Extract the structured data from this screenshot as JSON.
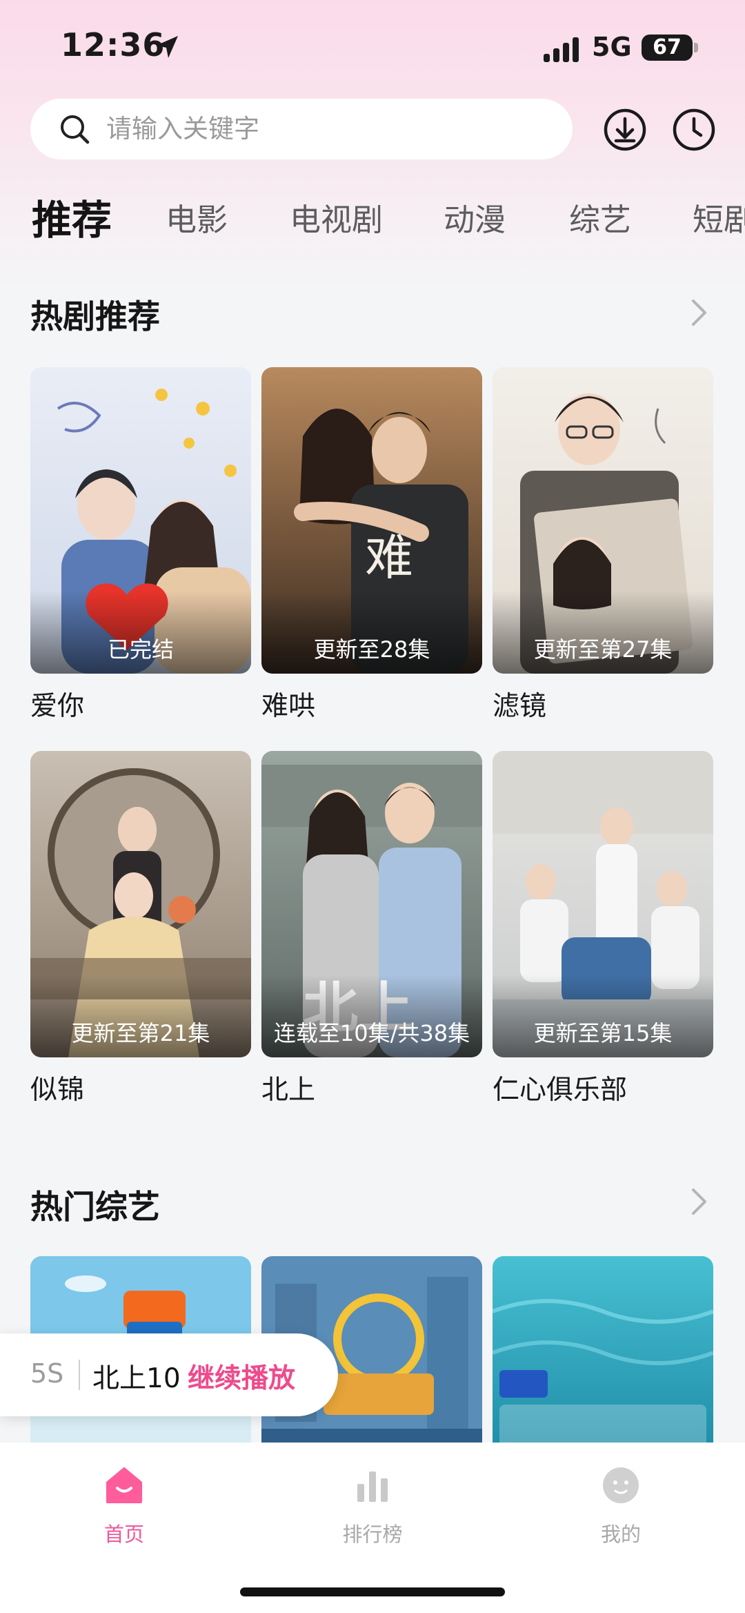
{
  "status_bar": {
    "time": "12:36",
    "network": "5G",
    "battery": "67"
  },
  "search": {
    "placeholder": "请输入关键字"
  },
  "tabs": [
    {
      "label": "推荐",
      "active": true
    },
    {
      "label": "电影"
    },
    {
      "label": "电视剧"
    },
    {
      "label": "动漫"
    },
    {
      "label": "综艺"
    },
    {
      "label": "短剧"
    }
  ],
  "sections": {
    "hot_dramas": {
      "title": "热剧推荐",
      "items": [
        {
          "title": "爱你",
          "badge": "已完结"
        },
        {
          "title": "难哄",
          "badge": "更新至28集"
        },
        {
          "title": "滤镜",
          "badge": "更新至第27集"
        },
        {
          "title": "似锦",
          "badge": "更新至第21集"
        },
        {
          "title": "北上",
          "badge": "连载至10集/共38集"
        },
        {
          "title": "仁心俱乐部",
          "badge": "更新至第15集"
        }
      ]
    },
    "hot_variety": {
      "title": "热门综艺"
    }
  },
  "continue_watching": {
    "time": "5S",
    "title": "北上10",
    "action": "继续播放"
  },
  "bottom_nav": [
    {
      "label": "首页",
      "icon": "home-icon",
      "active": true
    },
    {
      "label": "排行榜",
      "icon": "ranking-icon"
    },
    {
      "label": "我的",
      "icon": "profile-icon"
    }
  ],
  "colors": {
    "accent": "#ee4b8c",
    "nav_active": "#f0579a",
    "background": "#f4f5f7"
  }
}
